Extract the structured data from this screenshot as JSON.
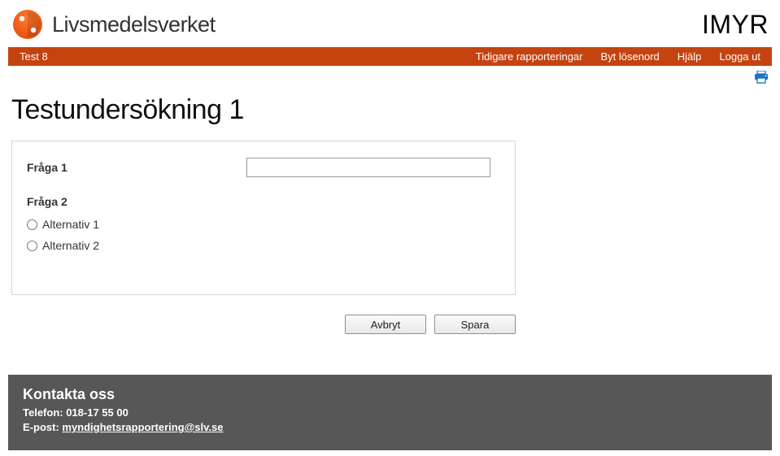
{
  "header": {
    "brand_name": "Livsmedelsverket",
    "app_name": "IMYR"
  },
  "navbar": {
    "left": "Test 8",
    "links": {
      "reports": "Tidigare rapporteringar",
      "password": "Byt lösenord",
      "help": "Hjälp",
      "logout": "Logga ut"
    }
  },
  "page": {
    "title": "Testundersökning 1"
  },
  "form": {
    "q1_label": "Fråga 1",
    "q1_value": "",
    "q2_label": "Fråga 2",
    "q2_options": {
      "opt1": "Alternativ 1",
      "opt2": "Alternativ 2"
    }
  },
  "buttons": {
    "cancel": "Avbryt",
    "save": "Spara"
  },
  "footer": {
    "title": "Kontakta oss",
    "phone_label": "Telefon: ",
    "phone_value": "018-17 55 00",
    "email_label": "E-post: ",
    "email_value": "myndighetsrapportering@slv.se"
  }
}
